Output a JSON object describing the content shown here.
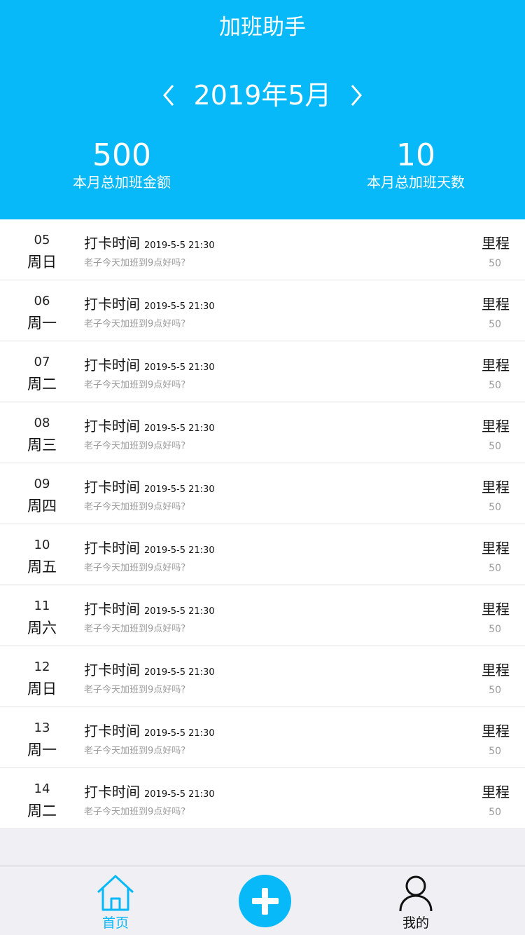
{
  "header": {
    "title": "加班助手",
    "month": "2019年5月",
    "total_amount": {
      "value": "500",
      "label": "本月总加班金额"
    },
    "total_days": {
      "value": "10",
      "label": "本月总加班天数"
    }
  },
  "colors": {
    "accent": "#07b9f9",
    "background": "#efeff4",
    "muted_text": "#9a9a9a"
  },
  "icons": {
    "prev": "chevron-left-icon",
    "next": "chevron-right-icon",
    "home": "home-icon",
    "add": "plus-icon",
    "profile": "user-icon"
  },
  "records": [
    {
      "day": "05",
      "weekday": "周日",
      "title": "打卡时间",
      "time": "2019-5-5 21:30",
      "note": "老子今天加班到9点好吗?",
      "metric_label": "里程",
      "metric_value": "50"
    },
    {
      "day": "06",
      "weekday": "周一",
      "title": "打卡时间",
      "time": "2019-5-5 21:30",
      "note": "老子今天加班到9点好吗?",
      "metric_label": "里程",
      "metric_value": "50"
    },
    {
      "day": "07",
      "weekday": "周二",
      "title": "打卡时间",
      "time": "2019-5-5 21:30",
      "note": "老子今天加班到9点好吗?",
      "metric_label": "里程",
      "metric_value": "50"
    },
    {
      "day": "08",
      "weekday": "周三",
      "title": "打卡时间",
      "time": "2019-5-5 21:30",
      "note": "老子今天加班到9点好吗?",
      "metric_label": "里程",
      "metric_value": "50"
    },
    {
      "day": "09",
      "weekday": "周四",
      "title": "打卡时间",
      "time": "2019-5-5 21:30",
      "note": "老子今天加班到9点好吗?",
      "metric_label": "里程",
      "metric_value": "50"
    },
    {
      "day": "10",
      "weekday": "周五",
      "title": "打卡时间",
      "time": "2019-5-5 21:30",
      "note": "老子今天加班到9点好吗?",
      "metric_label": "里程",
      "metric_value": "50"
    },
    {
      "day": "11",
      "weekday": "周六",
      "title": "打卡时间",
      "time": "2019-5-5 21:30",
      "note": "老子今天加班到9点好吗?",
      "metric_label": "里程",
      "metric_value": "50"
    },
    {
      "day": "12",
      "weekday": "周日",
      "title": "打卡时间",
      "time": "2019-5-5 21:30",
      "note": "老子今天加班到9点好吗?",
      "metric_label": "里程",
      "metric_value": "50"
    },
    {
      "day": "13",
      "weekday": "周一",
      "title": "打卡时间",
      "time": "2019-5-5 21:30",
      "note": "老子今天加班到9点好吗?",
      "metric_label": "里程",
      "metric_value": "50"
    },
    {
      "day": "14",
      "weekday": "周二",
      "title": "打卡时间",
      "time": "2019-5-5 21:30",
      "note": "老子今天加班到9点好吗?",
      "metric_label": "里程",
      "metric_value": "50"
    }
  ],
  "tabbar": {
    "home_label": "首页",
    "me_label": "我的"
  }
}
